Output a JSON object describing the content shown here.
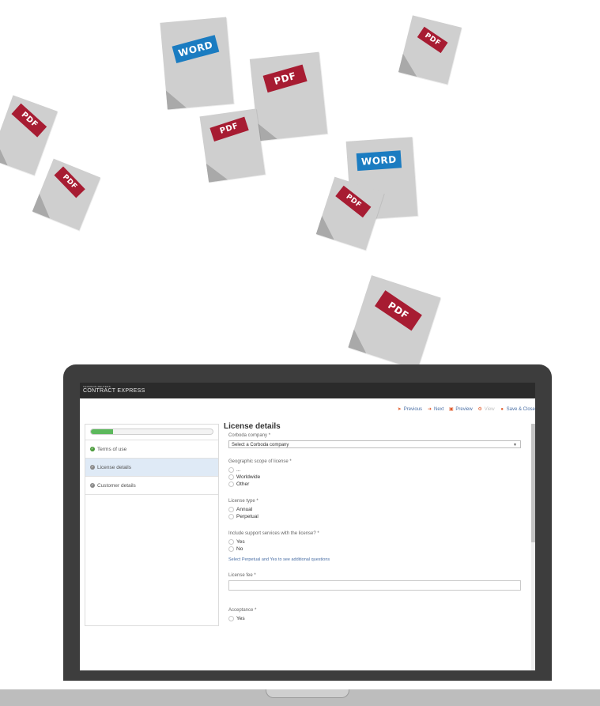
{
  "floating_docs": [
    {
      "kind": "word",
      "label": "WORD"
    },
    {
      "kind": "pdf",
      "label": "PDF"
    },
    {
      "kind": "pdf",
      "label": "PDF"
    },
    {
      "kind": "pdf",
      "label": "PDF"
    },
    {
      "kind": "pdf",
      "label": "PDF"
    },
    {
      "kind": "pdf",
      "label": "PDF"
    },
    {
      "kind": "word",
      "label": "WORD"
    },
    {
      "kind": "pdf",
      "label": "PDF"
    },
    {
      "kind": "pdf",
      "label": "PDF"
    }
  ],
  "app": {
    "brand_small": "THOMSON REUTERS",
    "brand": "CONTRACT EXPRESS"
  },
  "toolbar": {
    "previous": "Previous",
    "next": "Next",
    "preview": "Preview",
    "view": "View",
    "save_close": "Save & Close"
  },
  "sidebar": {
    "progress": 0.18,
    "items": [
      {
        "label": "Terms of use",
        "status": "done",
        "active": false
      },
      {
        "label": "License details",
        "status": "pending",
        "active": true
      },
      {
        "label": "Customer details",
        "status": "pending",
        "active": false
      }
    ]
  },
  "form": {
    "title": "License details",
    "company": {
      "label": "Corboda company *",
      "value": "Select a Corboda company"
    },
    "scope": {
      "label": "Geographic scope of license *",
      "options": [
        "...",
        "Worldwide",
        "Other"
      ]
    },
    "license_type": {
      "label": "License type *",
      "options": [
        "Annual",
        "Perpetual"
      ]
    },
    "support": {
      "label": "Include support services with the license? *",
      "options": [
        "Yes",
        "No"
      ]
    },
    "hint": "Select Perpetual and Yes to see additional questions",
    "fee": {
      "label": "License fee *"
    },
    "acceptance": {
      "label": "Acceptance *",
      "first_option": "Yes"
    }
  },
  "colors": {
    "pdf": "#a71c32",
    "word": "#1b7cc1",
    "progress": "#5cb85c",
    "laptop": "#3d3d3d"
  }
}
